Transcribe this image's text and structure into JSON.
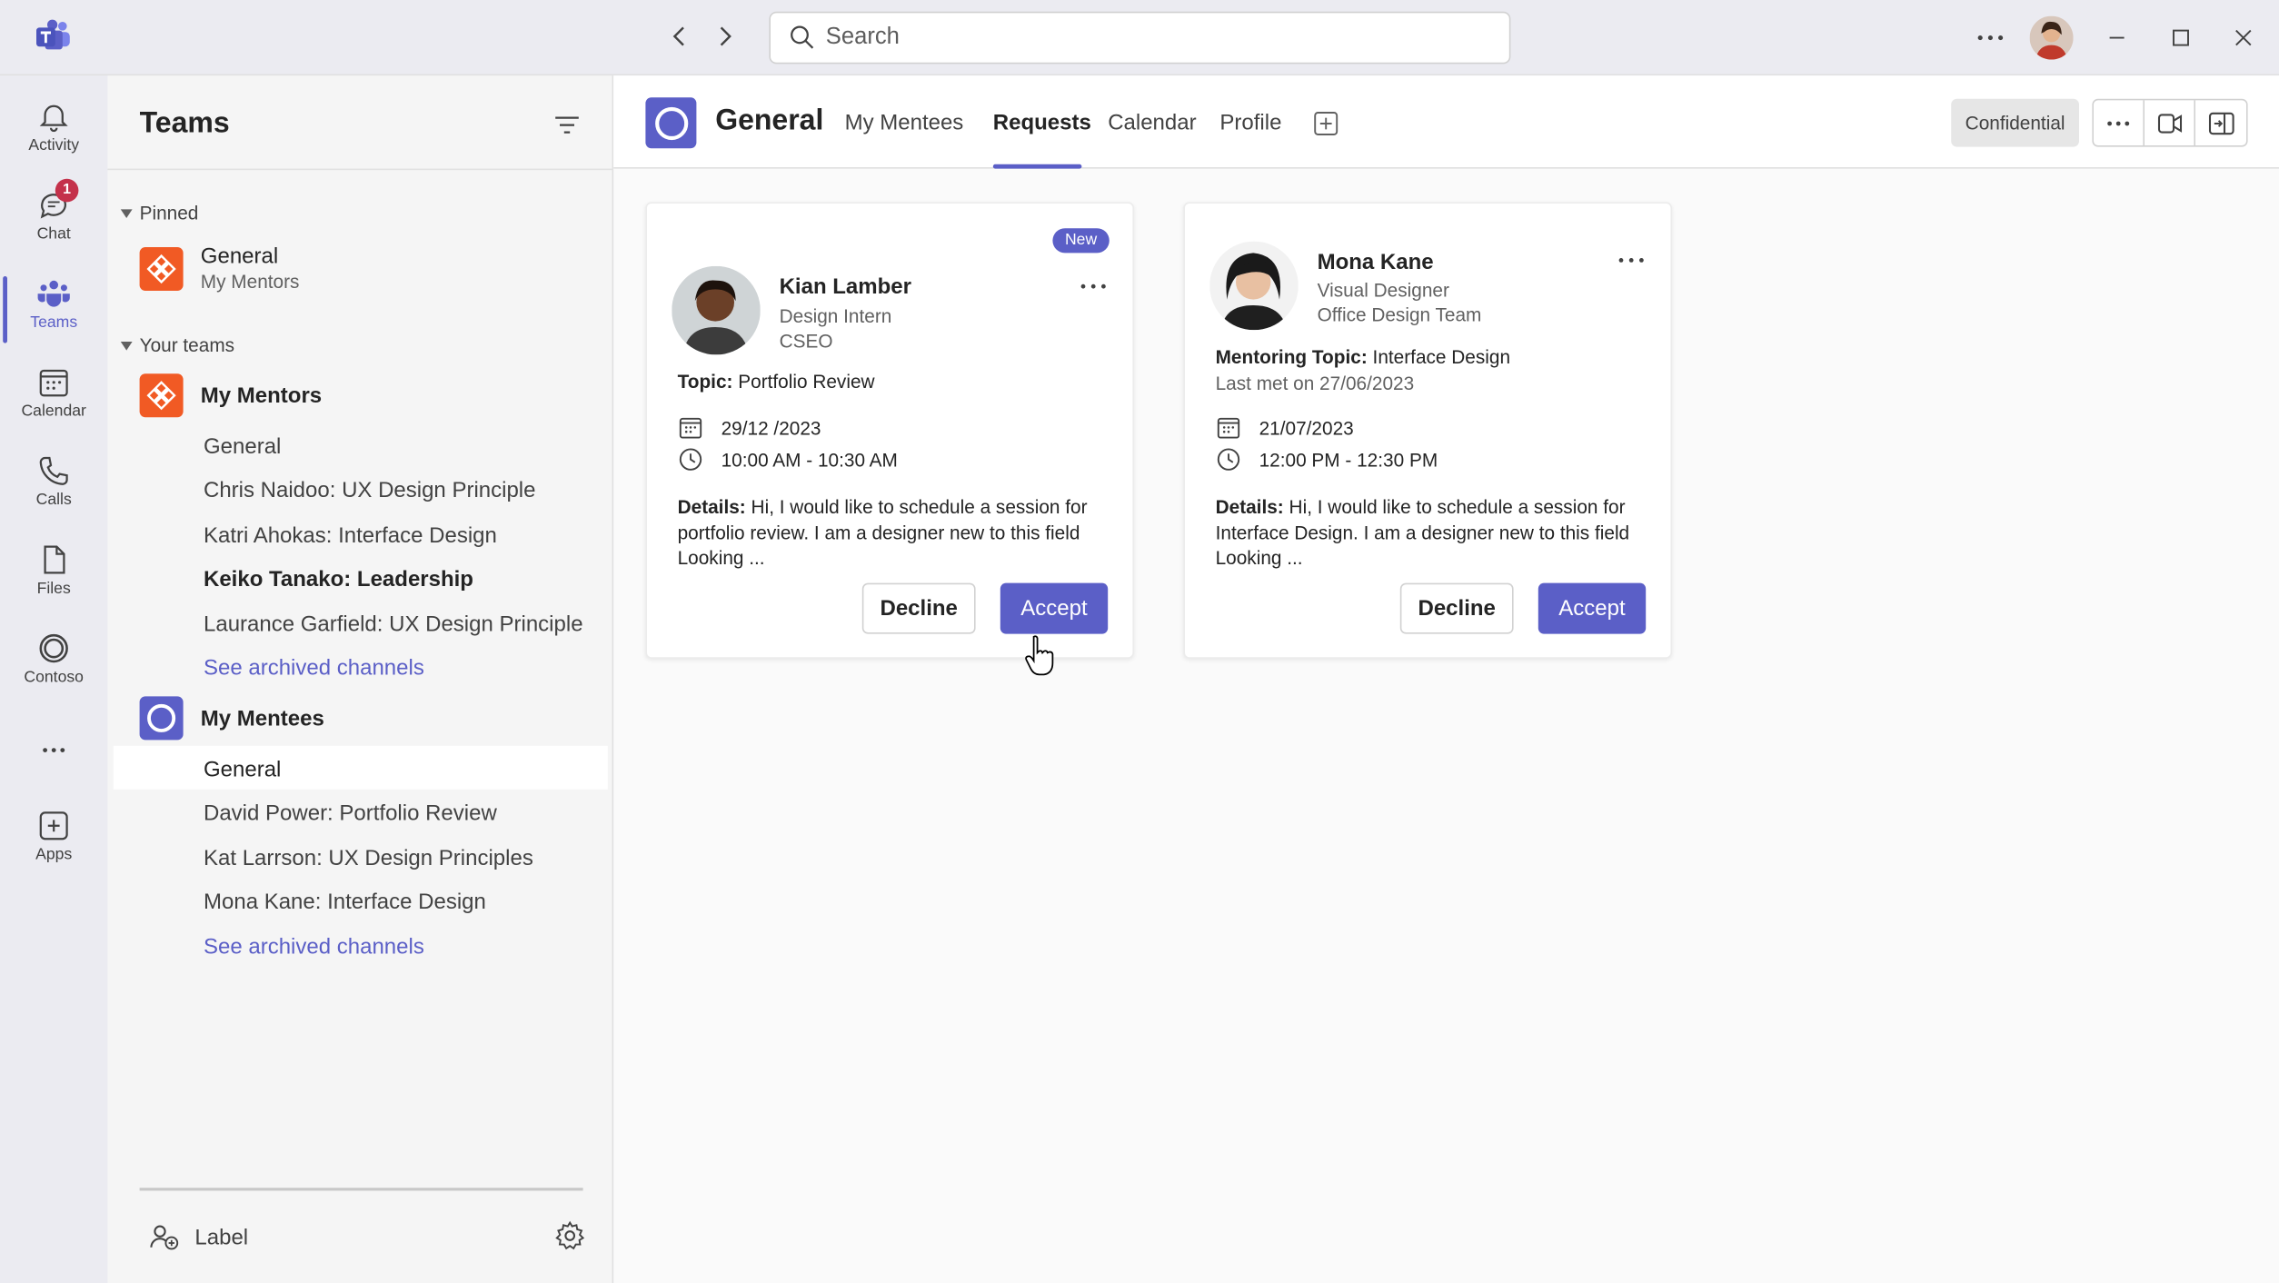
{
  "titlebar": {
    "search_placeholder": "Search"
  },
  "rail": {
    "items": [
      {
        "label": "Activity",
        "icon": "bell-icon"
      },
      {
        "label": "Chat",
        "icon": "chat-icon",
        "badge": "1"
      },
      {
        "label": "Teams",
        "icon": "teams-icon",
        "active": true
      },
      {
        "label": "Calendar",
        "icon": "calendar-icon"
      },
      {
        "label": "Calls",
        "icon": "phone-icon"
      },
      {
        "label": "Files",
        "icon": "file-icon"
      },
      {
        "label": "Contoso",
        "icon": "contoso-icon"
      },
      {
        "label": "Apps",
        "icon": "add-app-icon"
      }
    ]
  },
  "sidebar": {
    "title": "Teams",
    "pinned_label": "Pinned",
    "pinned": {
      "name": "General",
      "team": "My Mentors"
    },
    "your_teams_label": "Your teams",
    "teams": [
      {
        "name": "My Mentors",
        "channels": [
          "General",
          "Chris Naidoo: UX Design Principle",
          "Katri Ahokas: Interface Design",
          "Keiko Tanako: Leadership",
          "Laurance Garfield: UX Design Principle"
        ],
        "archived": "See archived channels"
      },
      {
        "name": "My Mentees",
        "channels": [
          "General",
          "David Power: Portfolio Review",
          "Kat Larrson: UX Design Principles",
          "Mona Kane: Interface Design"
        ],
        "archived": "See archived channels"
      }
    ],
    "footer_label": "Label"
  },
  "main": {
    "channel_title": "General",
    "tabs": [
      "My Mentees",
      "Requests",
      "Calendar",
      "Profile"
    ],
    "active_tab": "Requests",
    "confidential": "Confidential",
    "cards": [
      {
        "badge": "New",
        "name": "Kian Lamber",
        "role": "Design Intern",
        "org": "CSEO",
        "topic_label": "Topic:",
        "topic": "Portfolio Review",
        "date": "29/12 /2023",
        "time": "10:00 AM - 10:30 AM",
        "details_label": "Details:",
        "details": "Hi, I would like to schedule a session for portfolio review. I am a designer new to this field Looking ...",
        "decline": "Decline",
        "accept": "Accept"
      },
      {
        "name": "Mona Kane",
        "role": "Visual Designer",
        "org": "Office Design Team",
        "topic_label": "Mentoring Topic:",
        "topic": "Interface Design",
        "last_met": "Last met on 27/06/2023",
        "date": "21/07/2023",
        "time": "12:00 PM - 12:30 PM",
        "details_label": "Details:",
        "details": "Hi, I would like to schedule a session for Interface Design. I am a designer new to this field Looking ...",
        "decline": "Decline",
        "accept": "Accept"
      }
    ]
  },
  "colors": {
    "accent": "#5b5fc7",
    "orange": "#f15a24",
    "badge_red": "#c4314b"
  }
}
